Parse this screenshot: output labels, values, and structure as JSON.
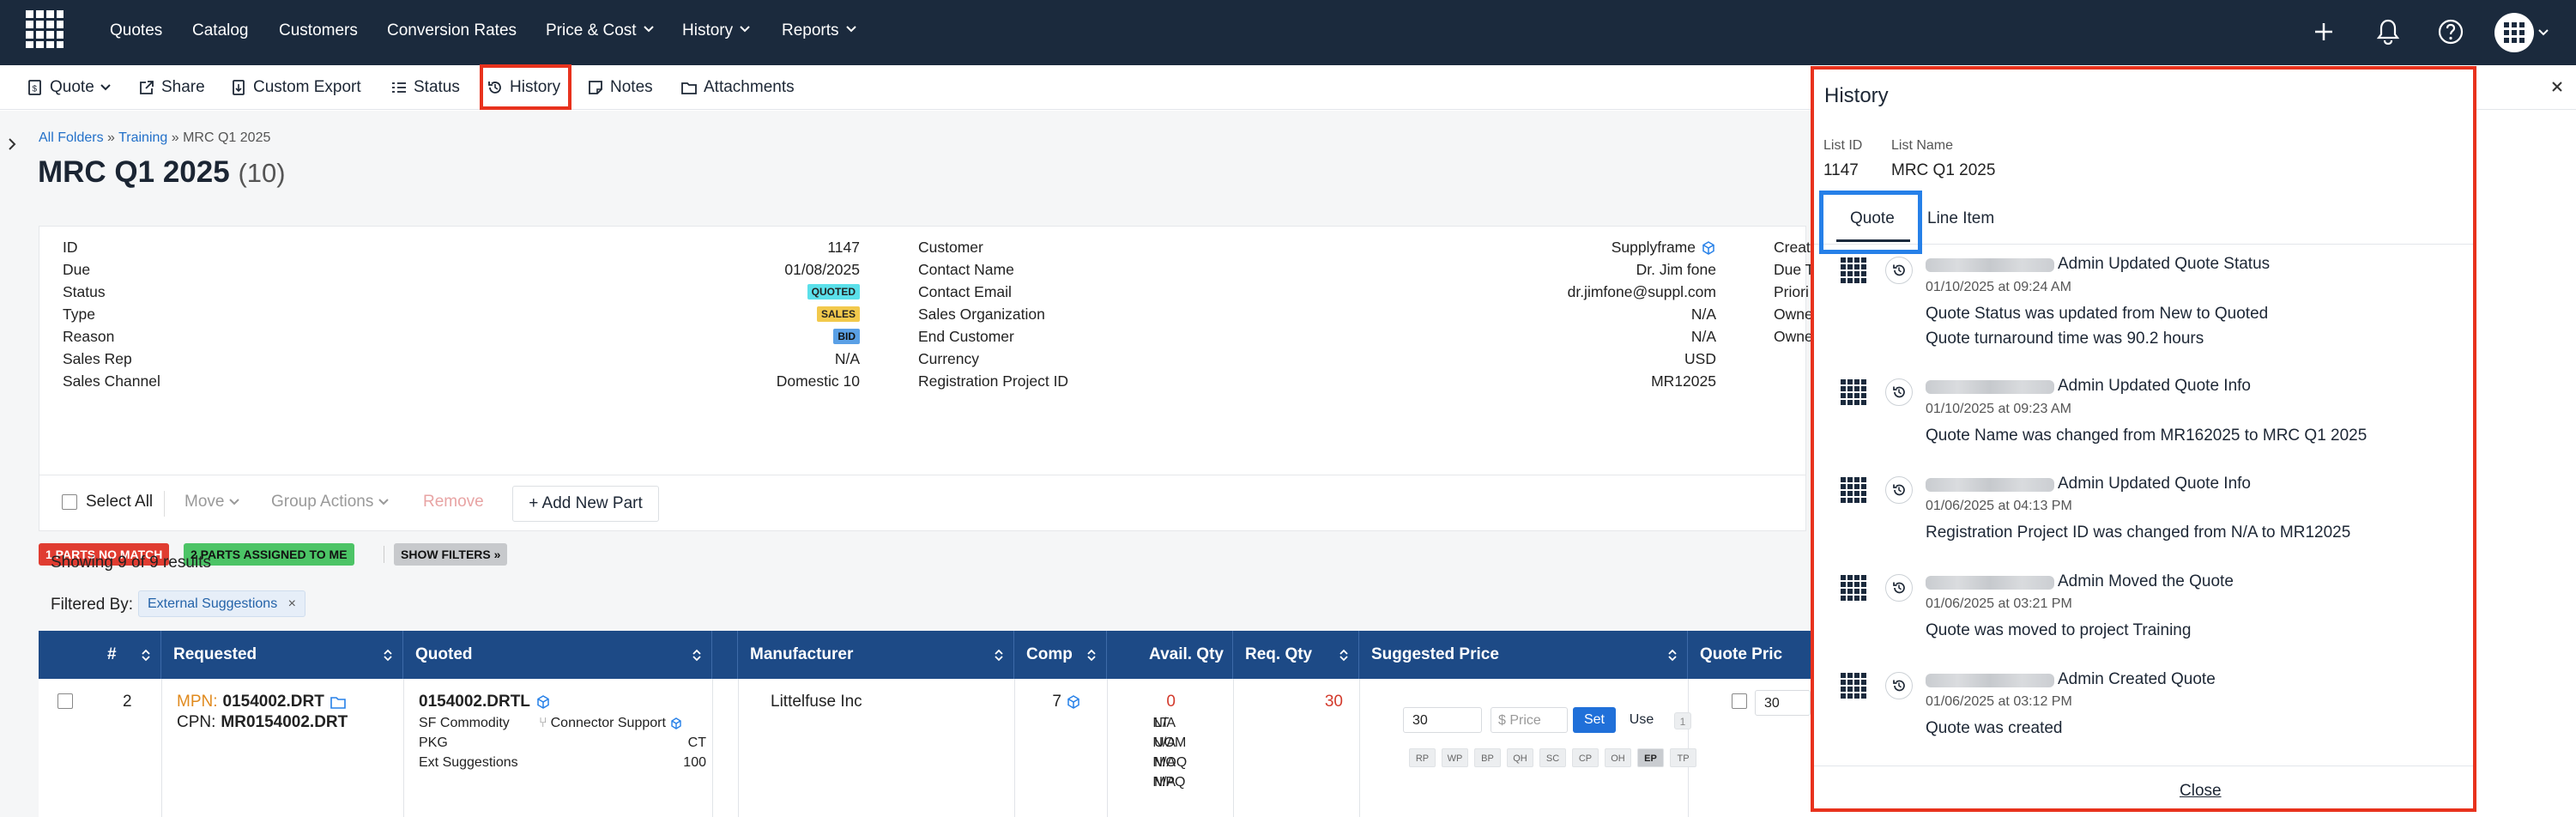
{
  "nav": {
    "items": [
      "Quotes",
      "Catalog",
      "Customers",
      "Conversion Rates",
      "Price & Cost",
      "History",
      "Reports"
    ],
    "icons": [
      "app-grid-icon",
      "plus-icon",
      "bell-icon",
      "help-icon",
      "apps-menu-icon"
    ]
  },
  "toolbar": {
    "items": [
      "Quote",
      "Share",
      "Custom Export",
      "Status",
      "History",
      "Notes",
      "Attachments"
    ]
  },
  "breadcrumb": {
    "items": [
      "All Folders",
      "Training",
      "MRC Q1 2025"
    ],
    "sep": " » "
  },
  "title": {
    "name": "MRC Q1 2025",
    "count": "(10)"
  },
  "info": {
    "col1": [
      {
        "label": "ID",
        "value": "1147"
      },
      {
        "label": "Due",
        "value": "01/08/2025"
      },
      {
        "label": "Status",
        "value": "QUOTED"
      },
      {
        "label": "Type",
        "value": "SALES"
      },
      {
        "label": "Reason",
        "value": "BID"
      },
      {
        "label": "Sales Rep",
        "value": "N/A"
      },
      {
        "label": "Sales Channel",
        "value": "Domestic 10"
      }
    ],
    "col2": [
      {
        "label": "Customer",
        "value": "Supplyframe"
      },
      {
        "label": "Contact Name",
        "value": "Dr. Jim fone"
      },
      {
        "label": "Contact Email",
        "value": "dr.jimfone@suppl.com"
      },
      {
        "label": "Sales Organization",
        "value": "N/A"
      },
      {
        "label": "End Customer",
        "value": "N/A"
      },
      {
        "label": "Currency",
        "value": "USD"
      },
      {
        "label": "Registration Project ID",
        "value": "MR12025"
      }
    ],
    "col3": [
      "Creat",
      "Due T",
      "Priori",
      "Owne",
      "Owne"
    ],
    "badge_colors": {
      "QUOTED": "#5be0ea",
      "SALES": "#f2c94c",
      "BID": "#5aa0e6"
    }
  },
  "chips": [
    {
      "text": "1 PARTS NO MATCH",
      "bg": "#e03c31",
      "color": "#fff"
    },
    {
      "text": "2 PARTS ASSIGNED TO ME",
      "bg": "#4cc466",
      "color": "#111"
    },
    {
      "text": "SHOW FILTERS »",
      "bg": "#c7c9cc",
      "color": "#111"
    }
  ],
  "actions": {
    "select_all": "Select All",
    "move": "Move",
    "group_actions": "Group Actions",
    "remove": "Remove",
    "add_part": "+ Add New Part"
  },
  "results": "Showing 9 of 9 results",
  "filter": {
    "label": "Filtered By:",
    "chip": "External Suggestions"
  },
  "table": {
    "columns": [
      "#",
      "Requested",
      "Quoted",
      "Manufacturer",
      "Comp",
      "Avail. Qty",
      "Req. Qty",
      "Suggested Price",
      "Quote Pric"
    ],
    "row": {
      "num": "2",
      "mpn_label": "MPN:",
      "mpn": "0154002.DRT",
      "cpn_label": "CPN:",
      "cpn": "MR0154002.DRT",
      "quoted_pn": "0154002.DRTL",
      "sf_commodity_label": "SF Commodity",
      "sf_commodity": "Connector Support",
      "pkg_label": "PKG",
      "pkg": "CT",
      "ext_label": "Ext Suggestions",
      "ext": "100",
      "manufacturer": "Littelfuse Inc",
      "comp": "7",
      "avail_main": "0",
      "avail_rows": [
        {
          "label": "LT",
          "value": "N/A"
        },
        {
          "label": "UOM",
          "value": "N/A"
        },
        {
          "label": "MOQ",
          "value": "N/A"
        },
        {
          "label": "MPQ",
          "value": "N/A"
        }
      ],
      "req_qty": "30",
      "price_qty": "30",
      "price_placeholder": "$ Price",
      "set_label": "Set",
      "use_label": "Use",
      "one_label": "1",
      "sources": [
        "RP",
        "WP",
        "BP",
        "QH",
        "SC",
        "CP",
        "OH",
        "EP",
        "TP"
      ],
      "quote_qty": "30"
    }
  },
  "history_panel": {
    "title": "History",
    "list_id_label": "List ID",
    "list_id": "1147",
    "list_name_label": "List Name",
    "list_name": "MRC Q1 2025",
    "tabs": [
      "Quote",
      "Line Item"
    ],
    "entries": [
      {
        "head": "Admin Updated Quote Status",
        "ts": "01/10/2025 at 09:24 AM",
        "lines": [
          "Quote Status was updated from New to Quoted",
          "Quote turnaround time was 90.2 hours"
        ]
      },
      {
        "head": "Admin Updated Quote Info",
        "ts": "01/10/2025 at 09:23 AM",
        "lines": [
          "Quote Name was changed from MR162025 to MRC Q1 2025"
        ]
      },
      {
        "head": "Admin Updated Quote Info",
        "ts": "01/06/2025 at 04:13 PM",
        "lines": [
          "Registration Project ID was changed from N/A to MR12025"
        ]
      },
      {
        "head": "Admin Moved the Quote",
        "ts": "01/06/2025 at 03:21 PM",
        "lines": [
          "Quote was moved to project Training"
        ]
      },
      {
        "head": "Admin Created Quote",
        "ts": "01/06/2025 at 03:12 PM",
        "lines": [
          "Quote was created"
        ]
      }
    ],
    "close_label": "Close"
  }
}
